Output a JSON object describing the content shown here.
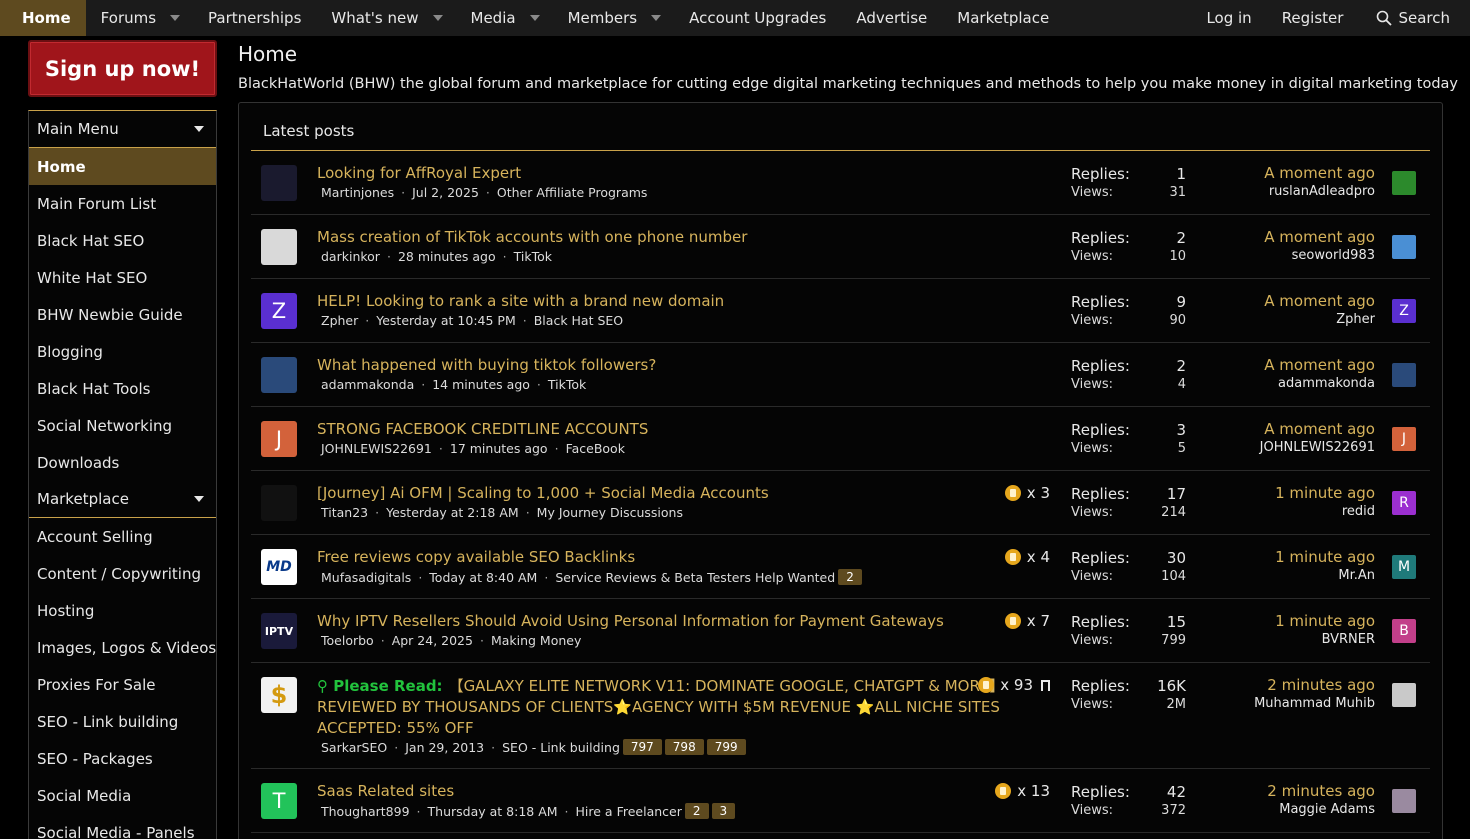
{
  "nav": {
    "items": [
      {
        "label": "Home",
        "active": true,
        "caret": false
      },
      {
        "label": "Forums",
        "caret": true
      },
      {
        "label": "Partnerships",
        "caret": false
      },
      {
        "label": "What's new",
        "caret": true
      },
      {
        "label": "Media",
        "caret": true
      },
      {
        "label": "Members",
        "caret": true
      },
      {
        "label": "Account Upgrades",
        "caret": false
      },
      {
        "label": "Advertise",
        "caret": false
      },
      {
        "label": "Marketplace",
        "caret": false
      }
    ],
    "login": "Log in",
    "register": "Register",
    "search": "Search"
  },
  "signup": "Sign up now!",
  "sidebar": {
    "main_menu": "Main Menu",
    "items": [
      "Home",
      "Main Forum List",
      "Black Hat SEO",
      "White Hat SEO",
      "BHW Newbie Guide",
      "Blogging",
      "Black Hat Tools",
      "Social Networking",
      "Downloads"
    ],
    "marketplace": "Marketplace",
    "market_items": [
      "Account Selling",
      "Content / Copywriting",
      "Hosting",
      "Images, Logos & Videos",
      "Proxies For Sale",
      "SEO - Link building",
      "SEO - Packages",
      "Social Media",
      "Social Media - Panels"
    ]
  },
  "page": {
    "title": "Home",
    "description": "BlackHatWorld (BHW) the global forum and marketplace for cutting edge digital marketing techniques and methods to help you make money in digital marketing today"
  },
  "latest": {
    "title": "Latest posts",
    "replies_label": "Replies:",
    "views_label": "Views:",
    "threads": [
      {
        "title": "Looking for AffRoyal Expert",
        "author": "Martinjones",
        "date": "Jul 2, 2025",
        "forum": "Other Affiliate Programs",
        "replies": "1",
        "views": "31",
        "last_time": "A moment ago",
        "last_user": "ruslanAdleadpro",
        "avatar_letter": "",
        "avatar_color": "#1a1a2e",
        "mini_letter": "",
        "mini_color": "#2c8a2c"
      },
      {
        "title": "Mass creation of TikTok accounts with one phone number",
        "author": "darkinkor",
        "date": "28 minutes ago",
        "forum": "TikTok",
        "replies": "2",
        "views": "10",
        "last_time": "A moment ago",
        "last_user": "seoworld983",
        "avatar_letter": "",
        "avatar_color": "#d9d9d9",
        "mini_letter": "",
        "mini_color": "#4a8fd4"
      },
      {
        "title": "HELP! Looking to rank a site with a brand new domain",
        "author": "Zpher",
        "date": "Yesterday at 10:45 PM",
        "forum": "Black Hat SEO",
        "replies": "9",
        "views": "90",
        "last_time": "A moment ago",
        "last_user": "Zpher",
        "avatar_letter": "Z",
        "avatar_color": "#5a2fd0",
        "mini_letter": "Z",
        "mini_color": "#5a2fd0"
      },
      {
        "title": "What happened with buying tiktok followers?",
        "author": "adammakonda",
        "date": "14 minutes ago",
        "forum": "TikTok",
        "replies": "2",
        "views": "4",
        "last_time": "A moment ago",
        "last_user": "adammakonda",
        "avatar_letter": "",
        "avatar_color": "#2a4a7a",
        "mini_letter": "",
        "mini_color": "#2a4a7a"
      },
      {
        "title": "STRONG FACEBOOK CREDITLINE ACCOUNTS",
        "author": "JOHNLEWIS22691",
        "date": "17 minutes ago",
        "forum": "FaceBook",
        "replies": "3",
        "views": "5",
        "last_time": "A moment ago",
        "last_user": "JOHNLEWIS22691",
        "avatar_letter": "J",
        "avatar_color": "#d3623b",
        "mini_letter": "J",
        "mini_color": "#d3623b"
      },
      {
        "title": "[Journey] Ai OFM | Scaling to 1,000 + Social Media Accounts",
        "author": "Titan23",
        "date": "Yesterday at 2:18 AM",
        "forum": "My Journey Discussions",
        "reactions": "x 3",
        "replies": "17",
        "views": "214",
        "last_time": "1 minute ago",
        "last_user": "redid",
        "avatar_letter": "",
        "avatar_color": "#111111",
        "mini_letter": "R",
        "mini_color": "#9b2fd0"
      },
      {
        "title": "Free reviews copy available SEO Backlinks",
        "author": "Mufasadigitals",
        "date": "Today at 8:40 AM",
        "forum": "Service Reviews & Beta Testers Help Wanted",
        "pages": [
          "2"
        ],
        "reactions": "x 4",
        "replies": "30",
        "views": "104",
        "last_time": "1 minute ago",
        "last_user": "Mr.An",
        "avatar_letter": "MD",
        "avatar_color": "#ffffff",
        "mini_letter": "M",
        "mini_color": "#1f7a7a"
      },
      {
        "title": "Why IPTV Resellers Should Avoid Using Personal Information for Payment Gateways",
        "author": "Toelorbo",
        "date": "Apr 24, 2025",
        "forum": "Making Money",
        "reactions": "x 7",
        "replies": "15",
        "views": "799",
        "last_time": "1 minute ago",
        "last_user": "BVRNER",
        "avatar_letter": "IPTV",
        "avatar_color": "#1a1a3a",
        "mini_letter": "B",
        "mini_color": "#c23f8a"
      },
      {
        "prefix": "Please Read:",
        "title": "【GALAXY ELITE NETWORK V11: DOMINATE GOOGLE, CHATGPT & MORE】REVIEWED BY THOUSANDS OF CLIENTS⭐AGENCY WITH $5M REVENUE ⭐ALL NICHE SITES ACCEPTED: 55% OFF",
        "author": "SarkarSEO",
        "date": "Jan 29, 2013",
        "forum": "SEO - Link building",
        "pages": [
          "797",
          "798",
          "799"
        ],
        "reactions": "x 93",
        "sticky": true,
        "replies": "16K",
        "views": "2M",
        "last_time": "2 minutes ago",
        "last_user": "Muhammad Muhib",
        "avatar_letter": "$",
        "avatar_color": "#f2f2f2",
        "mini_letter": "",
        "mini_color": "#c9c9c9"
      },
      {
        "title": "Saas Related sites",
        "author": "Thoughart899",
        "date": "Thursday at 8:18 AM",
        "forum": "Hire a Freelancer",
        "pages": [
          "2",
          "3"
        ],
        "reactions": "x 13",
        "replies": "42",
        "views": "372",
        "last_time": "2 minutes ago",
        "last_user": "Maggie Adams",
        "avatar_letter": "T",
        "avatar_color": "#22c35a",
        "mini_letter": "",
        "mini_color": "#9a8aa0"
      }
    ]
  }
}
